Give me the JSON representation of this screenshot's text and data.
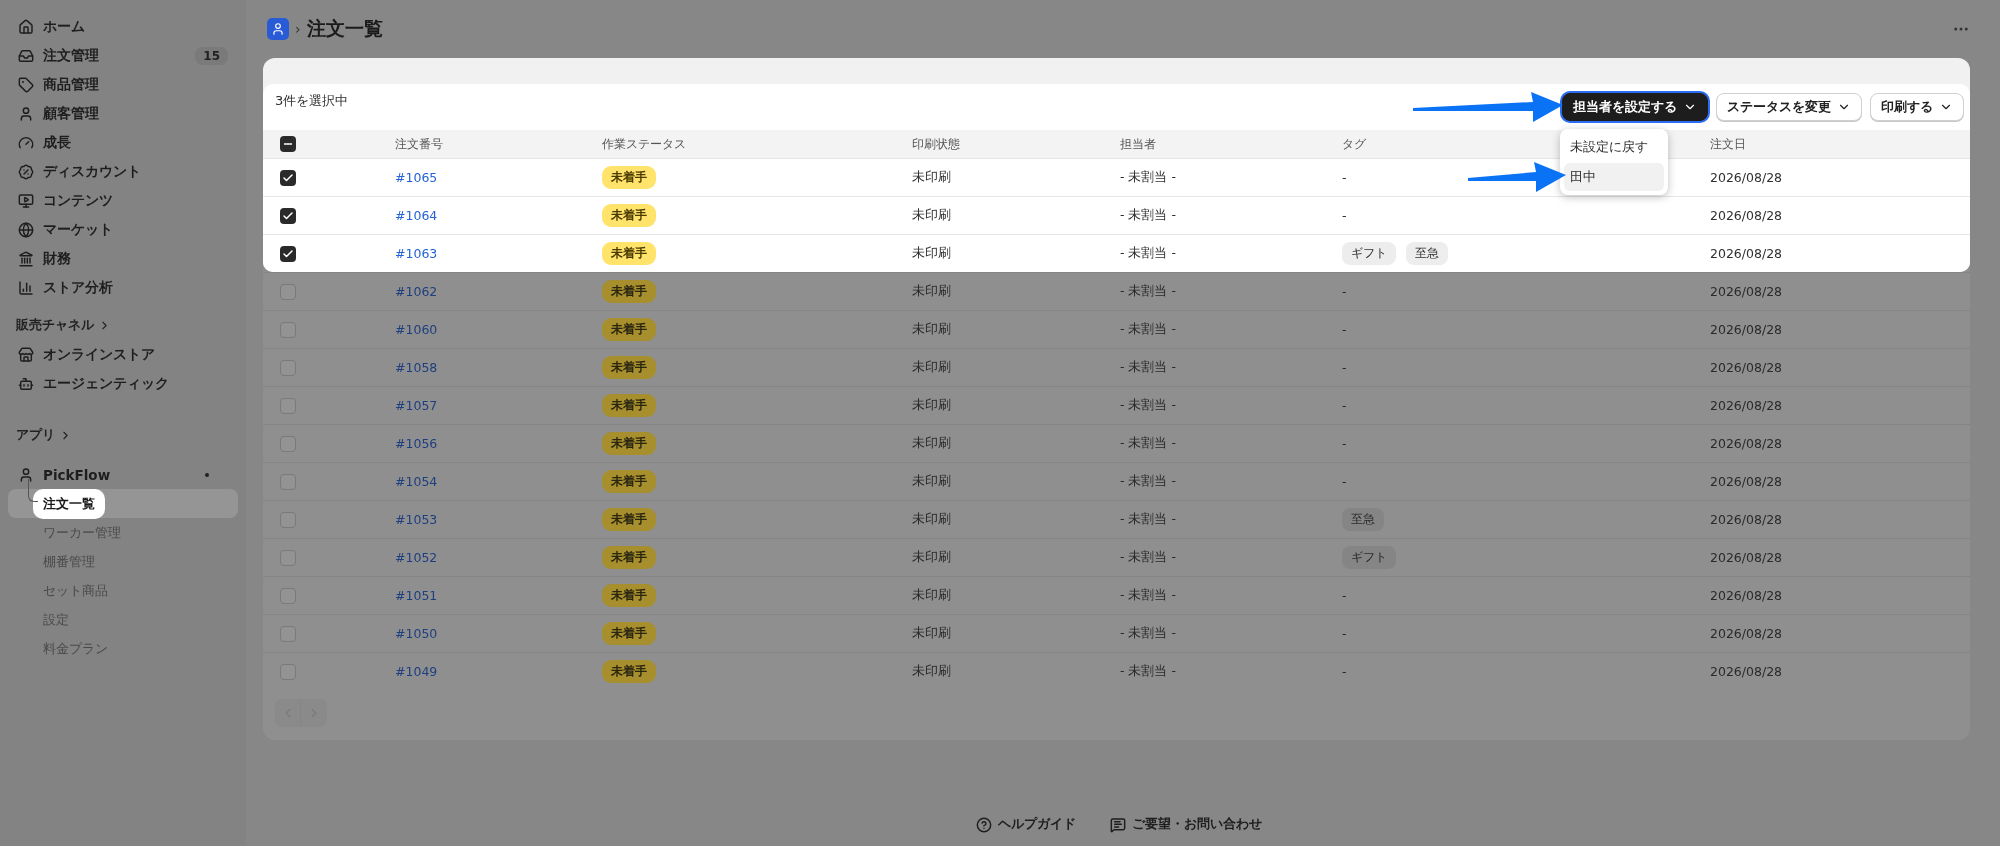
{
  "sidebar": {
    "nav": [
      {
        "label": "ホーム"
      },
      {
        "label": "注文管理",
        "badge": "15"
      },
      {
        "label": "商品管理"
      },
      {
        "label": "顧客管理"
      },
      {
        "label": "成長"
      },
      {
        "label": "ディスカウント"
      },
      {
        "label": "コンテンツ"
      },
      {
        "label": "マーケット"
      },
      {
        "label": "財務"
      },
      {
        "label": "ストア分析"
      }
    ],
    "channels": {
      "label": "販売チャネル",
      "items": [
        {
          "label": "オンラインストア"
        },
        {
          "label": "エージェンティック"
        }
      ]
    },
    "apps": {
      "label": "アプリ",
      "app": {
        "name": "PickFlow",
        "children": [
          {
            "label": "注文一覧",
            "selected": true
          },
          {
            "label": "ワーカー管理",
            "selected": false
          },
          {
            "label": "棚番管理",
            "selected": false
          },
          {
            "label": "セット商品",
            "selected": false
          },
          {
            "label": "設定",
            "selected": false
          },
          {
            "label": "料金プラン",
            "selected": false
          }
        ]
      }
    }
  },
  "header": {
    "breadcrumb_sep": "›",
    "title": "注文一覧"
  },
  "bulk_bar": {
    "selection": "3件を選択中",
    "buttons": [
      {
        "label": "担当者を設定する",
        "selected": true
      },
      {
        "label": "ステータスを変更",
        "selected": false
      },
      {
        "label": "印刷する",
        "selected": false
      }
    ],
    "menu": [
      {
        "label": "未設定に戻す",
        "selected": false
      },
      {
        "label": "田中",
        "selected": true
      }
    ]
  },
  "table": {
    "columns": [
      "注文番号",
      "作業ステータス",
      "印刷状態",
      "担当者",
      "タグ",
      "注文日"
    ],
    "select_all_indeterminate": true,
    "rows": [
      {
        "order": "#1065",
        "status": "未着手",
        "print": "未印刷",
        "assignee": "- 未割当 -",
        "tags": [],
        "date": "2026/08/28",
        "checked": true
      },
      {
        "order": "#1064",
        "status": "未着手",
        "print": "未印刷",
        "assignee": "- 未割当 -",
        "tags": [],
        "date": "2026/08/28",
        "checked": true
      },
      {
        "order": "#1063",
        "status": "未着手",
        "print": "未印刷",
        "assignee": "- 未割当 -",
        "tags": [
          "ギフト",
          "至急"
        ],
        "date": "2026/08/28",
        "checked": true
      },
      {
        "order": "#1062",
        "status": "未着手",
        "print": "未印刷",
        "assignee": "- 未割当 -",
        "tags": [],
        "date": "2026/08/28",
        "checked": false
      },
      {
        "order": "#1060",
        "status": "未着手",
        "print": "未印刷",
        "assignee": "- 未割当 -",
        "tags": [],
        "date": "2026/08/28",
        "checked": false
      },
      {
        "order": "#1058",
        "status": "未着手",
        "print": "未印刷",
        "assignee": "- 未割当 -",
        "tags": [],
        "date": "2026/08/28",
        "checked": false
      },
      {
        "order": "#1057",
        "status": "未着手",
        "print": "未印刷",
        "assignee": "- 未割当 -",
        "tags": [],
        "date": "2026/08/28",
        "checked": false
      },
      {
        "order": "#1056",
        "status": "未着手",
        "print": "未印刷",
        "assignee": "- 未割当 -",
        "tags": [],
        "date": "2026/08/28",
        "checked": false
      },
      {
        "order": "#1054",
        "status": "未着手",
        "print": "未印刷",
        "assignee": "- 未割当 -",
        "tags": [],
        "date": "2026/08/28",
        "checked": false
      },
      {
        "order": "#1053",
        "status": "未着手",
        "print": "未印刷",
        "assignee": "- 未割当 -",
        "tags": [
          "至急"
        ],
        "date": "2026/08/28",
        "checked": false
      },
      {
        "order": "#1052",
        "status": "未着手",
        "print": "未印刷",
        "assignee": "- 未割当 -",
        "tags": [
          "ギフト"
        ],
        "date": "2026/08/28",
        "checked": false
      },
      {
        "order": "#1051",
        "status": "未着手",
        "print": "未印刷",
        "assignee": "- 未割当 -",
        "tags": [],
        "date": "2026/08/28",
        "checked": false
      },
      {
        "order": "#1050",
        "status": "未着手",
        "print": "未印刷",
        "assignee": "- 未割当 -",
        "tags": [],
        "date": "2026/08/28",
        "checked": false
      },
      {
        "order": "#1049",
        "status": "未着手",
        "print": "未印刷",
        "assignee": "- 未割当 -",
        "tags": [],
        "date": "2026/08/28",
        "checked": false
      }
    ],
    "empty_cell": "-"
  },
  "footer": [
    {
      "label": "ヘルプガイド"
    },
    {
      "label": "ご要望・お問い合わせ"
    }
  ]
}
